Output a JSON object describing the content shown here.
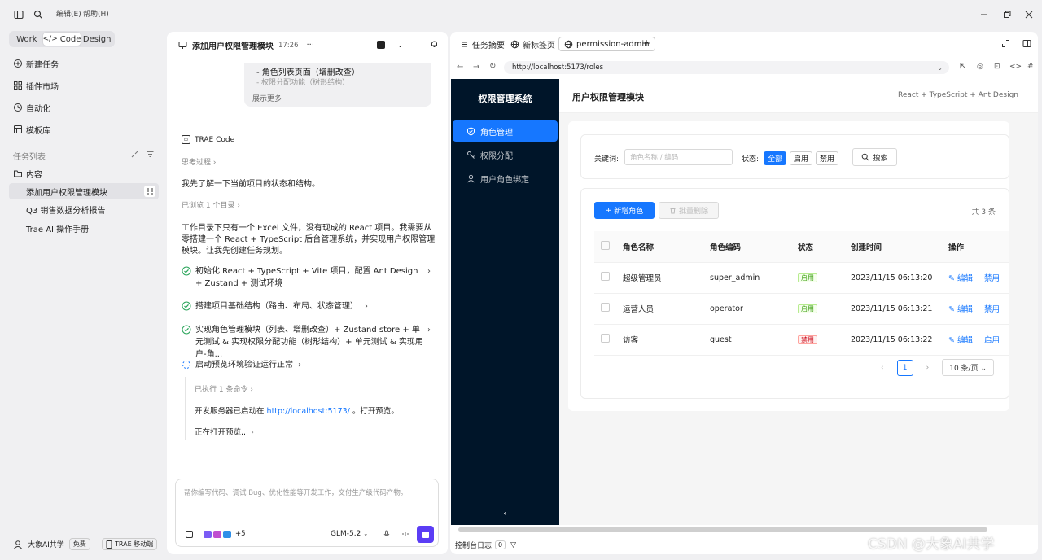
{
  "topbar": {
    "menu_edit": "编辑(E)",
    "menu_help": "帮助(H)"
  },
  "sidebar": {
    "modes": [
      "Work",
      "Code",
      "Design"
    ],
    "nav": [
      "新建任务",
      "插件市场",
      "自动化",
      "模板库"
    ],
    "task_list_title": "任务列表",
    "folder": "内容",
    "tasks": [
      "添加用户权限管理模块",
      "Q3 销售数据分析报告",
      "Trae AI 操作手册"
    ],
    "user_name": "大象AI共学",
    "plan_badge": "免费",
    "mobile_btn": "TRAE 移动端"
  },
  "chat": {
    "title": "添加用户权限管理模块",
    "time": "17:26",
    "bubble_line1": "- 角色列表页面（增删改查）",
    "bubble_line2": "- 权限分配功能（树形结构）",
    "show_more": "展示更多",
    "agent_name": "TRAE Code",
    "thinking": "思考过程",
    "msg1": "我先了解一下当前项目的状态和结构。",
    "browsed": "已浏览 1 个目录",
    "msg2": "工作目录下只有一个 Excel 文件，没有现成的 React 项目。我需要从零搭建一个 React + TypeScript 后台管理系统，并实现用户权限管理模块。让我先创建任务规划。",
    "steps": [
      "初始化 React + TypeScript + Vite 项目，配置 Ant Design + Zustand + 测试环境",
      "搭建项目基础结构（路由、布局、状态管理）",
      "实现角色管理模块（列表、增删改查）+ Zustand store + 单元测试 & 实现权限分配功能（树形结构）+ 单元测试 & 实现用户-角..."
    ],
    "running_step": "启动预览环境验证运行正常",
    "executed": "已执行 1 条命令",
    "server_msg_prefix": "开发服务器已启动在",
    "server_url": "http://localhost:5173/",
    "server_msg_suffix": "。打开预览。",
    "opening": "正在打开预览...",
    "input_placeholder": "帮你编写代码、调试 Bug、优化性能等开发工作，交付生产级代码产物。",
    "plus_count": "+5",
    "model": "GLM-5.2"
  },
  "browser": {
    "tabs": [
      "任务摘要",
      "新标签页",
      "permission-admin"
    ],
    "url": "http://localhost:5173/roles",
    "console_label": "控制台日志",
    "console_count": "0"
  },
  "app": {
    "system_title": "权限管理系统",
    "menu": [
      "角色管理",
      "权限分配",
      "用户角色绑定"
    ],
    "page_title": "用户权限管理模块",
    "tech": "React + TypeScript + Ant Design",
    "keyword_label": "关键词:",
    "keyword_placeholder": "角色名称 / 编码",
    "status_label": "状态:",
    "status_opts": [
      "全部",
      "启用",
      "禁用"
    ],
    "search_btn": "搜索",
    "add_btn": "新增角色",
    "batch_delete_btn": "批量删除",
    "total": "共 3 条",
    "columns": [
      "角色名称",
      "角色编码",
      "状态",
      "创建时间",
      "操作"
    ],
    "rows": [
      {
        "name": "超级管理员",
        "code": "super_admin",
        "status": "启用",
        "created": "2023/11/15 06:13:20",
        "edit": "编辑",
        "toggle": "禁用"
      },
      {
        "name": "运营人员",
        "code": "operator",
        "status": "启用",
        "created": "2023/11/15 06:13:21",
        "edit": "编辑",
        "toggle": "禁用"
      },
      {
        "name": "访客",
        "code": "guest",
        "status": "禁用",
        "created": "2023/11/15 06:13:22",
        "edit": "编辑",
        "toggle": "启用"
      }
    ],
    "page": "1",
    "page_size": "10 条/页"
  },
  "watermark": "CSDN @大象AI共学",
  "colors": {
    "primary": "#1677ff",
    "sider": "#001529",
    "purple": "#5b3df5"
  }
}
